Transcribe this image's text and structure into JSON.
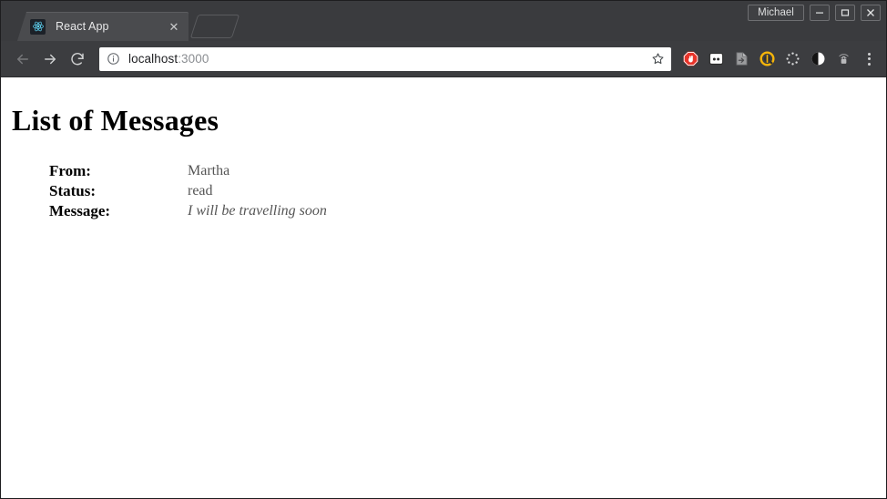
{
  "window": {
    "profile_label": "Michael",
    "minimize_label": "—",
    "maximize_label": "▢",
    "close_label": "✕"
  },
  "tabstrip": {
    "tabs": [
      {
        "title": "React App",
        "favicon": "react-atom-icon",
        "close_label": "✕"
      }
    ],
    "new_tab_label": ""
  },
  "toolbar": {
    "back_label": "←",
    "forward_label": "→",
    "reload_label": "⟳",
    "info_icon": "info-circle-icon",
    "url_host": "localhost",
    "url_port": ":3000",
    "bookmark_icon": "star-icon",
    "extensions": [
      {
        "name": "adblock-icon"
      },
      {
        "name": "lastpass-icon"
      },
      {
        "name": "page-action-icon"
      },
      {
        "name": "honey-icon"
      },
      {
        "name": "loading-ring-icon"
      },
      {
        "name": "dark-reader-icon"
      },
      {
        "name": "privacy-lock-icon"
      }
    ],
    "menu_icon": "three-dot-menu-icon"
  },
  "page": {
    "heading": "List of Messages",
    "labels": {
      "from": "From:",
      "status": "Status:",
      "message": "Message:"
    },
    "messages": [
      {
        "from": "Martha",
        "status": "read",
        "message": "I will be travelling soon"
      }
    ]
  }
}
